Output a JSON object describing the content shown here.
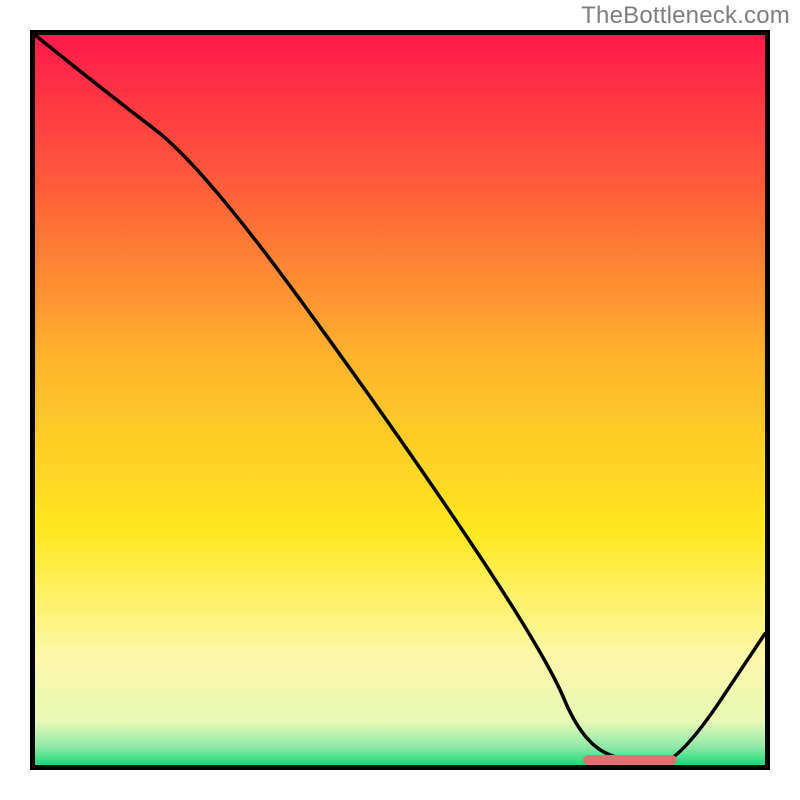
{
  "attribution": "TheBottleneck.com",
  "chart_data": {
    "type": "line",
    "title": "",
    "xlabel": "",
    "ylabel": "",
    "x_range": [
      0,
      100
    ],
    "y_range": [
      0,
      100
    ],
    "series": [
      {
        "name": "bottleneck-curve",
        "x": [
          0,
          10,
          23,
          50,
          70,
          75,
          82,
          88,
          100
        ],
        "y": [
          100,
          92,
          82,
          45,
          15,
          3,
          0,
          0,
          18
        ]
      }
    ],
    "marker": {
      "name": "optimal-range-marker",
      "x_start": 75,
      "x_end": 88,
      "y": 0,
      "color": "#e27070"
    },
    "gradient_stops": [
      {
        "offset": 0,
        "color": "#ff1a4b"
      },
      {
        "offset": 0.2,
        "color": "#ff5a3a"
      },
      {
        "offset": 0.45,
        "color": "#ffb62c"
      },
      {
        "offset": 0.68,
        "color": "#ffe81f"
      },
      {
        "offset": 0.85,
        "color": "#fdf8a8"
      },
      {
        "offset": 0.94,
        "color": "#e7f9b6"
      },
      {
        "offset": 0.975,
        "color": "#8fe9a8"
      },
      {
        "offset": 1.0,
        "color": "#1fd77a"
      }
    ]
  }
}
